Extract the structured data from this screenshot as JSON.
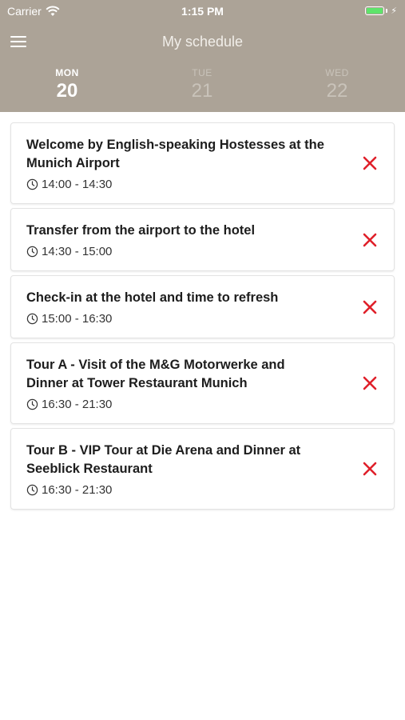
{
  "status_bar": {
    "carrier": "Carrier",
    "time": "1:15 PM"
  },
  "header": {
    "title": "My schedule"
  },
  "days": [
    {
      "name": "MON",
      "num": "20",
      "active": true
    },
    {
      "name": "TUE",
      "num": "21",
      "active": false
    },
    {
      "name": "WED",
      "num": "22",
      "active": false
    }
  ],
  "events": [
    {
      "title": "Welcome by English-speaking Hostesses at the Munich Airport",
      "time": "14:00 - 14:30"
    },
    {
      "title": "Transfer from the airport to the hotel",
      "time": "14:30 - 15:00"
    },
    {
      "title": "Check-in at the hotel and time to refresh",
      "time": "15:00 - 16:30"
    },
    {
      "title": "Tour A - Visit of the M&G Motorwerke and Dinner at Tower Restaurant Munich",
      "time": "16:30 - 21:30"
    },
    {
      "title": "Tour B - VIP Tour at Die Arena and Dinner at Seeblick Restaurant",
      "time": "16:30 - 21:30"
    }
  ],
  "icons": {
    "menu": "hamburger-menu-icon",
    "clock": "clock-icon",
    "remove": "close-x-icon",
    "wifi": "wifi-icon",
    "battery": "battery-icon"
  },
  "colors": {
    "header_bg": "#aca397",
    "remove_red": "#e0202a",
    "battery_green": "#5ee46b"
  }
}
